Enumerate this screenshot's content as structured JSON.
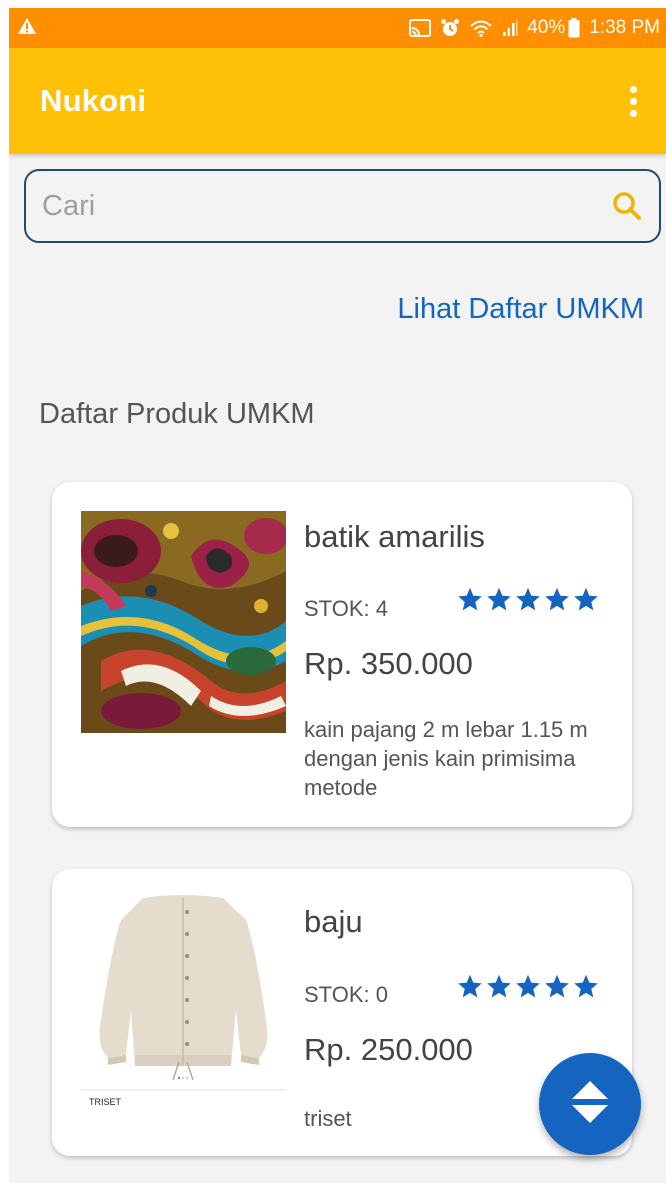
{
  "status_bar": {
    "battery": "40%",
    "time": "1:38 PM",
    "icons": [
      "warning-icon",
      "cast-icon",
      "alarm-icon",
      "wifi-icon",
      "signal-icon",
      "battery-icon"
    ]
  },
  "app_bar": {
    "title": "Nukoni",
    "menu_icon": "more-vert-icon"
  },
  "search": {
    "placeholder": "Cari",
    "value": "",
    "icon": "search-icon"
  },
  "links": {
    "list_umkm": "Lihat Daftar UMKM"
  },
  "section": {
    "title": "Daftar Produk UMKM"
  },
  "products": [
    {
      "name": "batik amarilis",
      "stock_label": "STOK: 4",
      "rating": 5,
      "price": "Rp.  350.000",
      "description": "kain pajang  2 m lebar 1.15 m dengan jenis kain primisima metode",
      "image": "batik-fabric-image"
    },
    {
      "name": "baju",
      "stock_label": "STOK: 0",
      "rating": 5,
      "price": "Rp.  250.000",
      "description": "triset",
      "image": "shirt-image",
      "image_caption": "TRISET"
    }
  ],
  "fab": {
    "icon": "sort-arrows-icon"
  },
  "colors": {
    "status_bar": "#ff8f00",
    "app_bar": "#ffc107",
    "accent": "#1565c0",
    "background": "#f3f3f3"
  }
}
